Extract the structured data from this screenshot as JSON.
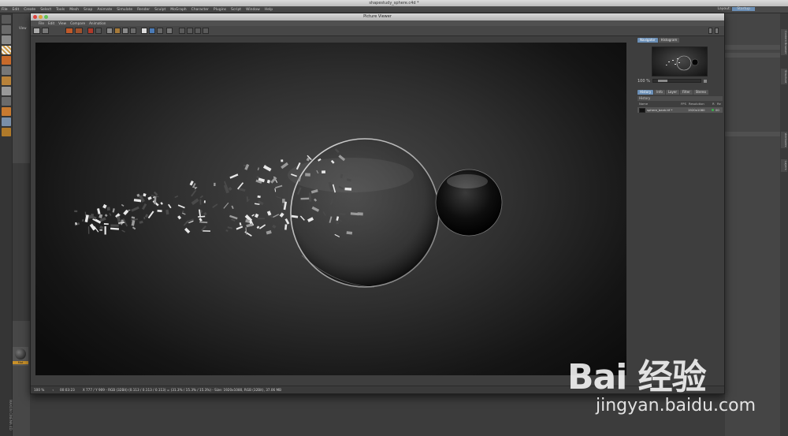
{
  "app": {
    "document_title": "shapestudy_sphere.c4d *",
    "menu": [
      "File",
      "Edit",
      "Create",
      "Select",
      "Tools",
      "Mesh",
      "Snap",
      "Animate",
      "Simulate",
      "Render",
      "Sculpt",
      "MoGraph",
      "Character",
      "Plugins",
      "Script",
      "Window",
      "Help"
    ],
    "layout_label": "Layout:",
    "layout_value": "Startup"
  },
  "viewer": {
    "title": "Picture Viewer",
    "menu": [
      "File",
      "Edit",
      "View",
      "Compare",
      "Animation"
    ],
    "status": {
      "zoom": "100 %",
      "time": "00:03:23",
      "pixel_info": "X 777 / Y 909 - RGB (32Bit) (0.113 / 0.113 / 0.113) = (31.3% / 15.3% / 15.3%) - Size: 1920x1080, RGB (32Bit), 37.06 MB"
    },
    "panel": {
      "tabs_top": [
        "Navigator",
        "Histogram"
      ],
      "zoom_value": "100 %",
      "tabs_bottom": [
        "History",
        "Info",
        "Layer",
        "Filter",
        "Stereo"
      ],
      "history_header": "History",
      "columns": [
        "Name",
        "FPS",
        "Resolution",
        "R",
        "Re"
      ],
      "rows": [
        {
          "name": "sphere_bank.tif *",
          "resolution": "1920x1080",
          "extra": "00"
        }
      ]
    }
  },
  "left": {
    "view_label": "View",
    "material_label": "Mat"
  },
  "vtabs": [
    "Content Browser",
    "Structure",
    "Attributes",
    "Layers"
  ],
  "watermark": {
    "brand": "Bai 经验",
    "url": "jingyan.baidu.com"
  },
  "colors": {
    "accent": "#6b8fb6",
    "status_green": "#39b54a"
  }
}
